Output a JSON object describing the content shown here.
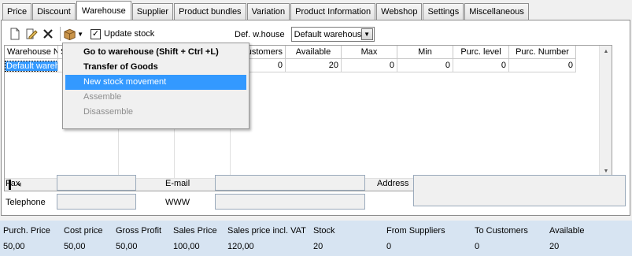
{
  "tabs": [
    "Price",
    "Discount",
    "Warehouse",
    "Supplier",
    "Product bundles",
    "Variation",
    "Product Information",
    "Webshop",
    "Settings",
    "Miscellaneous"
  ],
  "active_tab": "Warehouse",
  "toolbar": {
    "new_icon": "new-document-icon",
    "edit_icon": "edit-icon",
    "delete_icon": "delete-x-icon",
    "actions_icon": "box-icon",
    "update_stock_label": "Update stock",
    "update_stock_checked": "✓"
  },
  "default_warehouse": {
    "label": "Def. w.house",
    "value": "Default warehouse"
  },
  "grid": {
    "columns": [
      "Warehouse Na",
      "S",
      "",
      "",
      "Customers",
      "Available",
      "Max",
      "Min",
      "Purc. level",
      "Purc. Number"
    ],
    "row": {
      "warehouse": "Default wareh",
      "customers": "0",
      "available": "20",
      "max": "0",
      "min": "0",
      "purc_level": "0",
      "purc_number": "0"
    }
  },
  "context_menu": {
    "items": [
      {
        "label": "Go to warehouse  (Shift + Ctrl +L)",
        "state": "bold"
      },
      {
        "label": "Transfer of Goods",
        "state": "bold"
      },
      {
        "label": "New stock movement",
        "state": "highlighted"
      },
      {
        "label": "Assemble",
        "state": "disabled"
      },
      {
        "label": "Disassemble",
        "state": "disabled"
      }
    ]
  },
  "contact": {
    "fax_label": "Fax",
    "telephone_label": "Telephone",
    "email_label": "E-mail",
    "www_label": "WWW",
    "address_label": "Address"
  },
  "summary": {
    "headers": [
      "Purch. Price",
      "Cost price",
      "Gross Profit",
      "Sales Price",
      "Sales price incl. VAT",
      "Stock",
      "From Suppliers",
      "To Customers",
      "Available"
    ],
    "values": [
      "50,00",
      "50,00",
      "50,00",
      "100,00",
      "120,00",
      "20",
      "0",
      "0",
      "20"
    ]
  },
  "colors": {
    "selection": "#3399ff",
    "summary_bg": "#d7e4f2"
  }
}
